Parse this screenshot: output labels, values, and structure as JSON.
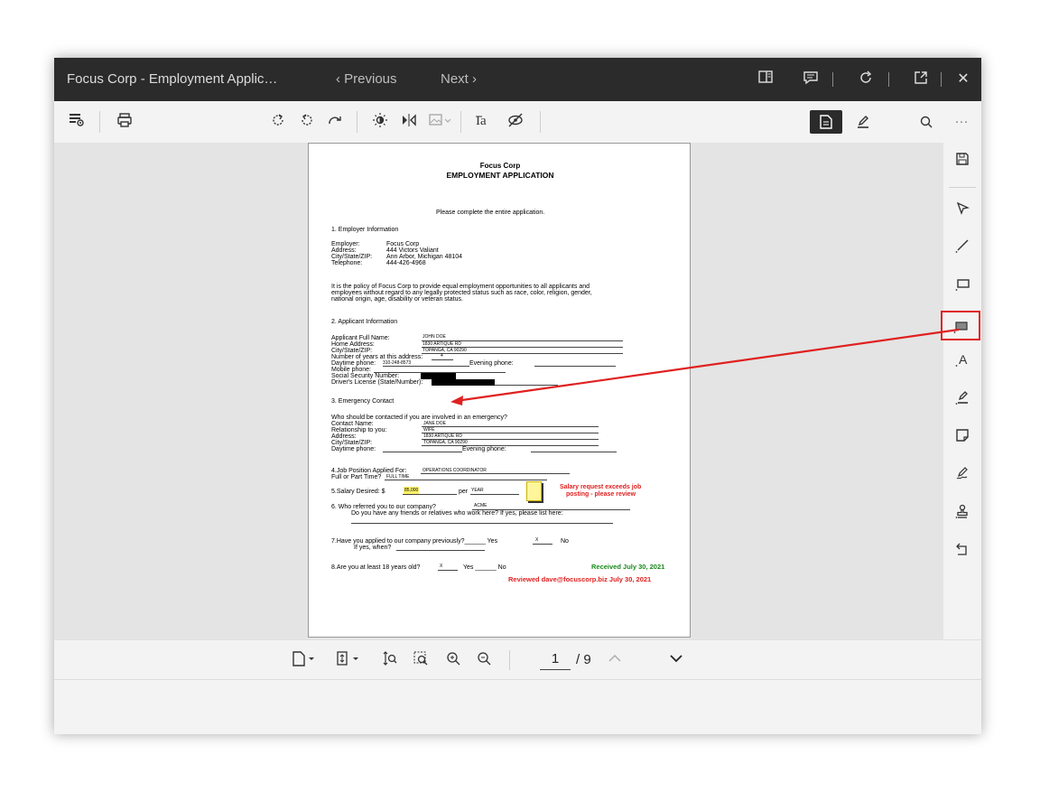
{
  "titlebar": {
    "title": "Focus Corp - Employment Applic…",
    "previous": "‹  Previous",
    "next": "Next  ›",
    "icons": [
      "sidebar-toggle-icon",
      "comment-icon",
      "redo-icon",
      "popout-icon",
      "close-icon"
    ]
  },
  "toolbar": {
    "icons": [
      "view-options-icon",
      "print-icon",
      "rotate-cw-icon",
      "rotate-ccw-icon",
      "rotate-180-icon",
      "brightness-icon",
      "flip-icon",
      "image-icon",
      "text-select-icon",
      "hide-icon"
    ],
    "modes": [
      "document-mode-icon",
      "annotate-mode-icon",
      "search-icon",
      "more-icon"
    ]
  },
  "document": {
    "company": "Focus Corp",
    "heading": "EMPLOYMENT APPLICATION",
    "intro": "Please complete the entire application.",
    "s1": "1.      Employer Information",
    "employer_labels": [
      "Employer:",
      "Address:",
      "City/State/ZIP:",
      "Telephone:"
    ],
    "employer_values": [
      "Focus Corp",
      "444 Victors Valiant",
      "Ann Arbor, Michigan 48104",
      "444-426-4968"
    ],
    "policy": [
      "It is the policy of Focus Corp to provide equal employment opportunities to all applicants and",
      "employees without regard to any legally protected status such as race, color, religion, gender,",
      "national origin, age, disability or veteran status."
    ],
    "s2": "2.      Applicant Information",
    "applicant_name_label": "Applicant Full Name:",
    "applicant_name": "JOHN DOE",
    "home_address_label": "Home Address:",
    "home_address": "1830 ARTIQUE RD",
    "city_label": "City/State/ZIP:",
    "city": "TOPANGA, CA 90290",
    "years_label": "Number of years at this address:",
    "years": "4",
    "daytime_label": "Daytime phone:",
    "daytime": "310-248-8573",
    "evening_label": "Evening phone:",
    "mobile_label": "Mobile phone:",
    "ssn_label": "Social Security Number:",
    "dl_label": "Driver's License (State/Number):",
    "s3": "3.      Emergency Contact",
    "ec_question": "Who should be contacted if you are involved in an emergency?",
    "contact_label": "Contact Name:",
    "contact": "JANE DOE",
    "relationship_label": "Relationship to you:",
    "relationship": "WIFE",
    "ec_address_label": "Address:",
    "ec_address": "1830 ARTIQUE RD",
    "ec_city_label": "City/State/ZIP:",
    "ec_city": "TOPANGA, CA 90290",
    "ec_daytime_label": "Daytime phone:",
    "ec_evening_label": "Evening phone:",
    "s4": "4.Job Position Applied For:",
    "position": "OPERATIONS COORDINATOR",
    "fullpart_label": "Full or Part Time?",
    "fullpart": "FULL TIME",
    "salary_label": "5.Salary Desired:   $",
    "salary": "85,000",
    "per_label": "per",
    "per": "YEAR",
    "salary_note": [
      "Salary request exceeds job",
      "posting - please review"
    ],
    "s6": "6.      Who referred you to our company?",
    "referral": "ACME",
    "friends": "Do you have any friends or relatives who work here? If yes, please list here:",
    "s7": "7.Have you applied to our company previously?______ Yes",
    "s7_x": "X",
    "s7_no": "No",
    "s7_when": "If yes, when?",
    "s8": "8.Are you at least 18 years old?",
    "s8_x": "X",
    "s8_rest": "Yes        ______ No",
    "received": "Received July 30, 2021",
    "reviewed": "Reviewed dave@focuscorp.biz July 30, 2021"
  },
  "rightbar": [
    "save-icon",
    "select-icon",
    "line-icon",
    "rectangle-icon",
    "redaction-icon",
    "text-icon",
    "highlight-icon",
    "note-icon",
    "signature-icon",
    "stamp-icon",
    "undo-icon"
  ],
  "bottombar": {
    "page_current": "1",
    "page_total": "/ 9"
  },
  "colors": {
    "titlebar": "#2b2b2b",
    "accent_red": "#e02020",
    "received_green": "#1a8a1a",
    "reviewed_red": "#e02020"
  }
}
